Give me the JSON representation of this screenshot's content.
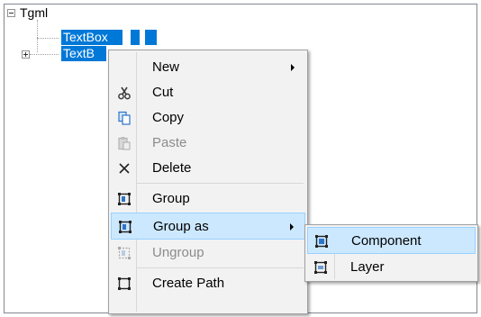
{
  "tree": {
    "root": {
      "label": "Tgml"
    },
    "children": [
      {
        "label": "TextBox",
        "selected": true
      },
      {
        "label": "TextBox",
        "selected": true,
        "truncated_label": "TextB"
      }
    ]
  },
  "context_menu": {
    "items": [
      {
        "label": "New",
        "icon": "none",
        "submenu": true,
        "enabled": true
      },
      {
        "label": "Cut",
        "icon": "scissors-icon",
        "enabled": true
      },
      {
        "label": "Copy",
        "icon": "copy-icon",
        "enabled": true
      },
      {
        "label": "Paste",
        "icon": "paste-icon",
        "enabled": false
      },
      {
        "label": "Delete",
        "icon": "delete-x-icon",
        "enabled": true
      },
      {
        "label": "Group",
        "icon": "group-icon",
        "enabled": true
      },
      {
        "label": "Group as",
        "icon": "group-as-icon",
        "submenu": true,
        "enabled": true,
        "highlighted": true
      },
      {
        "label": "Ungroup",
        "icon": "ungroup-icon",
        "enabled": false
      },
      {
        "label": "Create Path",
        "icon": "create-path-icon",
        "enabled": true
      }
    ]
  },
  "submenu": {
    "items": [
      {
        "label": "Component",
        "icon": "component-icon",
        "highlighted": true
      },
      {
        "label": "Layer",
        "icon": "layer-icon"
      }
    ]
  },
  "colors": {
    "selection": "#0078d7",
    "menu_bg": "#f2f2f2",
    "menu_highlight": "#cce8ff",
    "disabled_text": "#8c8c8c"
  }
}
